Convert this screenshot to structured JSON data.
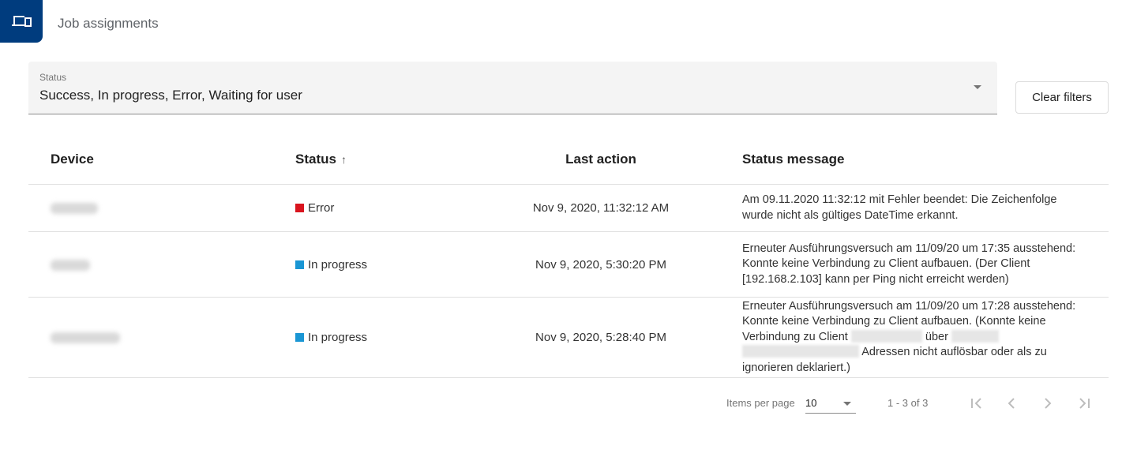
{
  "header": {
    "app_icon": "devices-icon",
    "title": "Job assignments"
  },
  "filter": {
    "label": "Status",
    "value": "Success, In progress, Error, Waiting for user"
  },
  "toolbar": {
    "clear_filters_label": "Clear filters"
  },
  "table": {
    "columns": {
      "device": "Device",
      "status": "Status",
      "status_sort": "ascending",
      "last_action": "Last action",
      "status_message": "Status message"
    },
    "rows": [
      {
        "device": "[redacted]",
        "status": "Error",
        "status_color": "#d9141e",
        "last_action": "Nov 9, 2020, 11:32:12 AM",
        "status_message": "Am 09.11.2020 11:32:12 mit Fehler beendet: Die Zeichenfolge wurde nicht als gültiges DateTime erkannt."
      },
      {
        "device": "[redacted]",
        "status": "In progress",
        "status_color": "#1a96d4",
        "last_action": "Nov 9, 2020, 5:30:20 PM",
        "status_message": "Erneuter Ausführungsversuch am 11/09/20 um 17:35 ausstehend: Konnte keine Verbindung zu Client aufbauen. (Der Client [192.168.2.103] kann per Ping nicht erreicht werden)"
      },
      {
        "device": "[redacted]",
        "status": "In progress",
        "status_color": "#1a96d4",
        "last_action": "Nov 9, 2020, 5:28:40 PM",
        "status_message_parts": {
          "a": "Erneuter Ausführungsversuch am 11/09/20 um 17:28 ausstehend: Konnte keine Verbindung zu Client aufbauen. (Konnte keine Verbindung zu Client",
          "b": "über",
          "c": "Adressen nicht auflösbar oder als zu ignorieren deklariert.)"
        }
      }
    ]
  },
  "paginator": {
    "items_per_page_label": "Items per page",
    "page_size": "10",
    "range": "1 - 3 of 3",
    "first_page_enabled": false,
    "prev_page_enabled": false,
    "next_page_enabled": false,
    "last_page_enabled": false
  }
}
